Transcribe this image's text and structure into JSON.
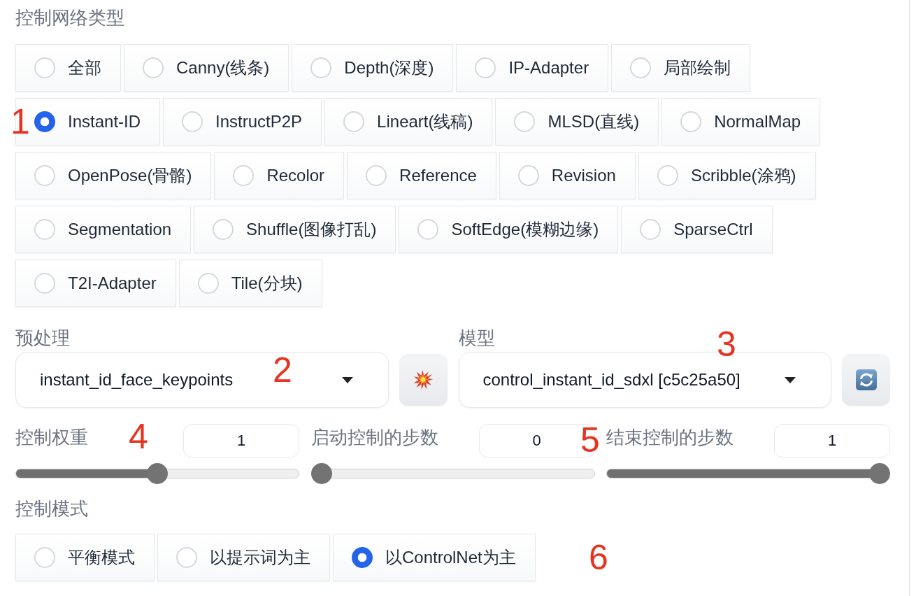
{
  "control_type": {
    "label": "控制网络类型",
    "options": [
      {
        "label": "全部",
        "selected": false
      },
      {
        "label": "Canny(线条)",
        "selected": false
      },
      {
        "label": "Depth(深度)",
        "selected": false
      },
      {
        "label": "IP-Adapter",
        "selected": false
      },
      {
        "label": "局部绘制",
        "selected": false
      },
      {
        "label": "Instant-ID",
        "selected": true
      },
      {
        "label": "InstructP2P",
        "selected": false
      },
      {
        "label": "Lineart(线稿)",
        "selected": false
      },
      {
        "label": "MLSD(直线)",
        "selected": false
      },
      {
        "label": "NormalMap",
        "selected": false
      },
      {
        "label": "OpenPose(骨骼)",
        "selected": false
      },
      {
        "label": "Recolor",
        "selected": false
      },
      {
        "label": "Reference",
        "selected": false
      },
      {
        "label": "Revision",
        "selected": false
      },
      {
        "label": "Scribble(涂鸦)",
        "selected": false
      },
      {
        "label": "Segmentation",
        "selected": false
      },
      {
        "label": "Shuffle(图像打乱)",
        "selected": false
      },
      {
        "label": "SoftEdge(模糊边缘)",
        "selected": false
      },
      {
        "label": "SparseCtrl",
        "selected": false
      },
      {
        "label": "T2I-Adapter",
        "selected": false
      },
      {
        "label": "Tile(分块)",
        "selected": false
      }
    ]
  },
  "preprocessor": {
    "label": "预处理",
    "value": "instant_id_face_keypoints"
  },
  "model": {
    "label": "模型",
    "value": "control_instant_id_sdxl [c5c25a50]"
  },
  "sliders": [
    {
      "label": "控制权重",
      "value": "1",
      "level": 0.5
    },
    {
      "label": "启动控制的步数",
      "value": "0",
      "level": 0
    },
    {
      "label": "结束控制的步数",
      "value": "1",
      "level": 1
    }
  ],
  "control_mode": {
    "label": "控制模式",
    "options": [
      {
        "label": "平衡模式",
        "selected": false
      },
      {
        "label": "以提示词为主",
        "selected": false
      },
      {
        "label": "以ControlNet为主",
        "selected": true
      }
    ]
  },
  "annotations": [
    "1",
    "2",
    "3",
    "4",
    "5",
    "6"
  ]
}
